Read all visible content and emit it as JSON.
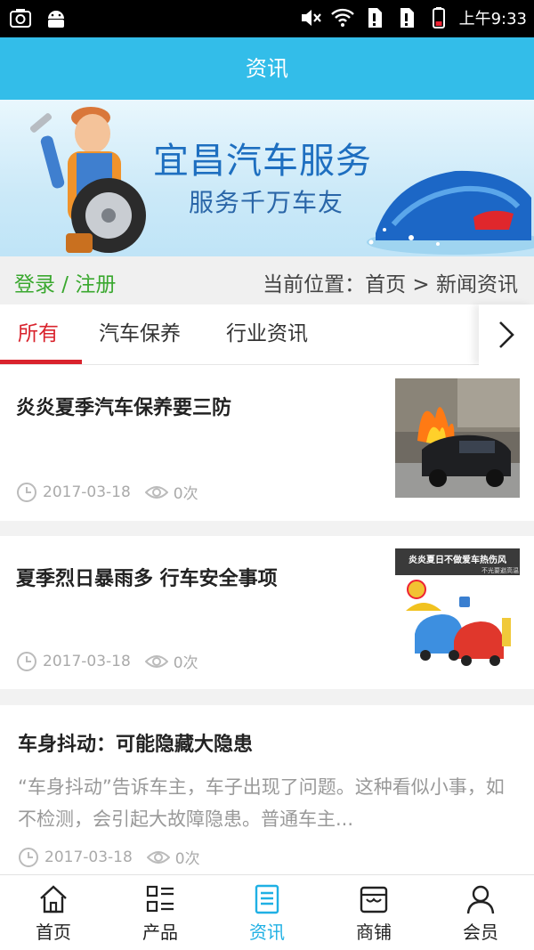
{
  "status_bar": {
    "left_icons": [
      "screenshot-icon",
      "android-icon"
    ],
    "right_icons": [
      "mute-icon",
      "wifi-icon",
      "sim1-icon",
      "sim2-icon",
      "battery-icon"
    ],
    "time": "上午9:33"
  },
  "header": {
    "title": "资讯"
  },
  "banner": {
    "title": "宜昌汽车服务",
    "subtitle": "服务千万车友"
  },
  "breadcrumb": {
    "login": "登录 / 注册",
    "location": "当前位置：首页 > 新闻资讯"
  },
  "tabs": {
    "items": [
      {
        "label": "所有",
        "active": true
      },
      {
        "label": "汽车保养",
        "active": false
      },
      {
        "label": "行业资讯",
        "active": false
      }
    ],
    "more_icon": "chevron-right-icon"
  },
  "news": [
    {
      "title": "炎炎夏季汽车保养要三防",
      "date": "2017-03-18",
      "views": "0次",
      "has_image": true
    },
    {
      "title": "夏季烈日暴雨多 行车安全事项",
      "date": "2017-03-18",
      "views": "0次",
      "has_image": true,
      "image_caption": "炎炎夏日不做爱车热伤风",
      "image_subcaption": "不光要避高温"
    },
    {
      "title": "车身抖动：可能隐藏大隐患",
      "excerpt": "“车身抖动”告诉车主，车子出现了问题。这种看似小事，如不检测，会引起大故障隐患。普通车主...",
      "date": "2017-03-18",
      "views": "0次",
      "has_image": false
    }
  ],
  "bottom_nav": [
    {
      "label": "首页",
      "icon": "home-icon",
      "active": false
    },
    {
      "label": "产品",
      "icon": "grid-list-icon",
      "active": false
    },
    {
      "label": "资讯",
      "icon": "news-doc-icon",
      "active": true
    },
    {
      "label": "商铺",
      "icon": "store-icon",
      "active": false
    },
    {
      "label": "会员",
      "icon": "user-icon",
      "active": false
    }
  ],
  "colors": {
    "accent": "#33bde9",
    "active_tab": "#d9232d",
    "login_green": "#3aa82f",
    "nav_active": "#1fb0e4"
  }
}
